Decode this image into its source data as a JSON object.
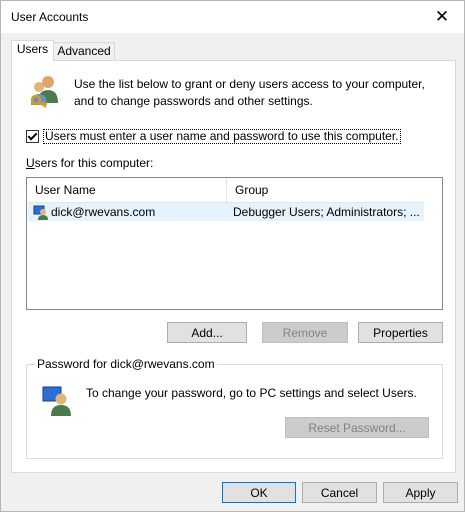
{
  "window": {
    "title": "User Accounts"
  },
  "tabs": [
    {
      "label": "Users",
      "active": true
    },
    {
      "label": "Advanced",
      "active": false
    }
  ],
  "intro": {
    "text": "Use the list below to grant or deny users access to your computer, and to change passwords and other settings."
  },
  "require_login": {
    "label": "Users must enter a user name and password to use this computer.",
    "checked": true
  },
  "users": {
    "label": "Users for this computer:",
    "columns": [
      "User Name",
      "Group"
    ],
    "rows": [
      {
        "name": "dick@rwevans.com",
        "group": "Debugger Users; Administrators; ..."
      }
    ]
  },
  "buttons": {
    "add": "Add...",
    "remove": "Remove",
    "properties": "Properties"
  },
  "password": {
    "legend": "Password for dick@rwevans.com",
    "text": "To change your password, go to PC settings and select Users.",
    "reset": "Reset Password..."
  },
  "footer": {
    "ok": "OK",
    "cancel": "Cancel",
    "apply": "Apply"
  }
}
